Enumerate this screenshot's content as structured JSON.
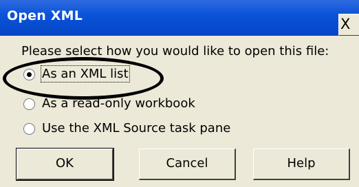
{
  "window": {
    "title": "Open XML",
    "close_glyph": "X"
  },
  "prompt": "Please select how you would like to open this file:",
  "options": [
    {
      "label": "As an XML list",
      "selected": true
    },
    {
      "label": "As a read-only workbook",
      "selected": false
    },
    {
      "label": "Use the XML Source task pane",
      "selected": false
    }
  ],
  "buttons": {
    "ok_label": "OK",
    "cancel_label": "Cancel",
    "help_label": "Help"
  },
  "annotation": {
    "shape": "ellipse",
    "color": "#000000",
    "highlights": "As an XML list"
  },
  "colors": {
    "title_bar": "#0b53d8",
    "dialog_bg": "#ece9d8"
  }
}
